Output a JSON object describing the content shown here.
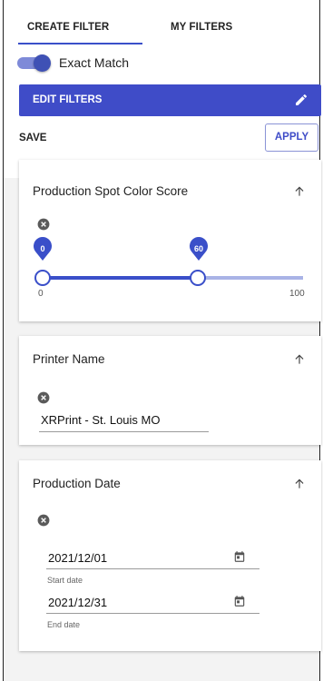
{
  "tabs": [
    {
      "label": "CREATE FILTER",
      "active": true
    },
    {
      "label": "MY FILTERS",
      "active": false
    }
  ],
  "exact_match": {
    "label": "Exact Match",
    "on": true
  },
  "edit_filters": {
    "label": "EDIT FILTERS",
    "icon": "pencil-icon"
  },
  "actions": {
    "save_label": "SAVE",
    "apply_label": "APPLY"
  },
  "filters": {
    "spot_color": {
      "title": "Production Spot Color Score",
      "min_value": "0",
      "max_value": "60",
      "scale_min": "0",
      "scale_max": "100"
    },
    "printer": {
      "title": "Printer Name",
      "value": "XRPrint - St. Louis MO"
    },
    "production_date": {
      "title": "Production Date",
      "start_value": "2021/12/01",
      "start_label": "Start date",
      "end_value": "2021/12/31",
      "end_label": "End date"
    }
  },
  "colors": {
    "accent": "#3f4cc8",
    "rail_inactive": "#a9b3e6"
  }
}
